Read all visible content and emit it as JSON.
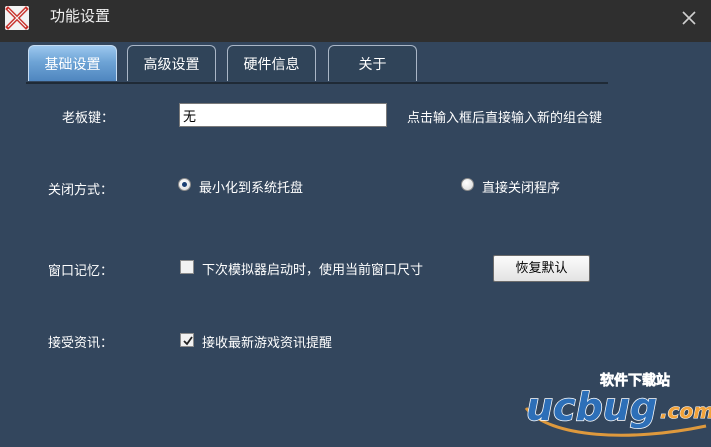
{
  "window": {
    "title": "功能设置",
    "logo_icon": "app-x-logo-icon",
    "close_icon": "close-icon"
  },
  "tabs": [
    {
      "label": "基础设置",
      "active": true
    },
    {
      "label": "高级设置",
      "active": false
    },
    {
      "label": "硬件信息",
      "active": false
    },
    {
      "label": "关于",
      "active": false
    }
  ],
  "boss_key": {
    "label": "老板键：",
    "value": "无",
    "hint": "点击输入框后直接输入新的组合键"
  },
  "close_mode": {
    "label": "关闭方式：",
    "options": [
      {
        "label": "最小化到系统托盘",
        "selected": true
      },
      {
        "label": "直接关闭程序",
        "selected": false
      }
    ]
  },
  "window_memory": {
    "label": "窗口记忆：",
    "checkbox_label": "下次模拟器启动时，使用当前窗口尺寸",
    "checked": false,
    "reset_button": "恢复默认"
  },
  "news": {
    "label": "接受资讯：",
    "checkbox_label": "接收最新游戏资讯提醒",
    "checked": true
  },
  "watermark": {
    "top_text": "软件下载站",
    "brand": "ucbug",
    "suffix": ".com"
  },
  "colors": {
    "background": "#33465d",
    "titlebar": "#2f2f2f",
    "tab_active": "#6ea4d6",
    "logo_red": "#c9322c"
  }
}
